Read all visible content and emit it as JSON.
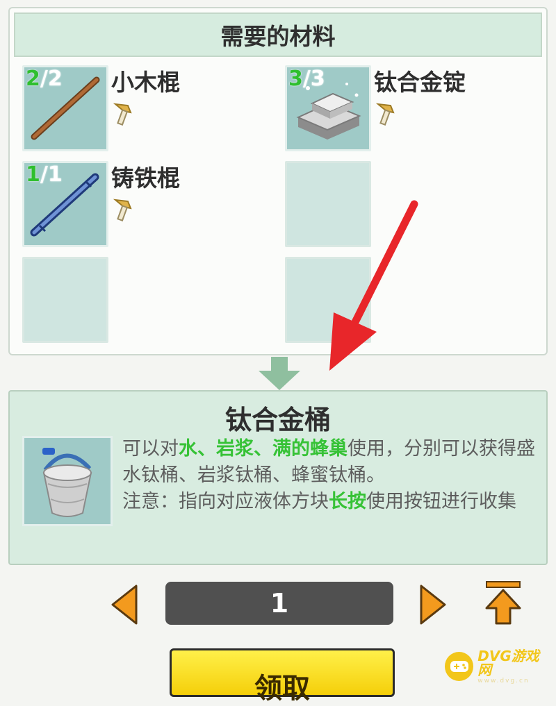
{
  "materials_panel": {
    "title": "需要的材料",
    "items": [
      {
        "name": "小木棍",
        "have": "2",
        "need": "2",
        "icon": "wooden-stick-icon"
      },
      {
        "name": "钛合金锭",
        "have": "3",
        "need": "3",
        "icon": "titanium-ingot-icon"
      },
      {
        "name": "铸铁棍",
        "have": "1",
        "need": "1",
        "icon": "cast-iron-rod-icon"
      }
    ],
    "count_separator": "/"
  },
  "result": {
    "title": "钛合金桶",
    "icon": "titanium-bucket-icon",
    "desc": {
      "p1": "可以对",
      "h1": "水、岩浆、满的蜂巢",
      "p2": "使用，分别可以获得盛水钛桶、岩浆钛桶、蜂蜜钛桶。",
      "p3": "注意：指向对应液体方块",
      "h2": "长按",
      "p4": "使用按钮进行收集"
    }
  },
  "quantity": {
    "value": "1"
  },
  "claim_button": {
    "label": "领取"
  },
  "watermark": {
    "main": "DVG游戏网",
    "sub": "www.dvg.cn"
  },
  "colors": {
    "have_count": "#2fbf2f",
    "highlight": "#36c236",
    "accent_orange": "#f39a1e",
    "claim_yellow": "#f5cf0a",
    "annotation_red": "#e8262a"
  }
}
